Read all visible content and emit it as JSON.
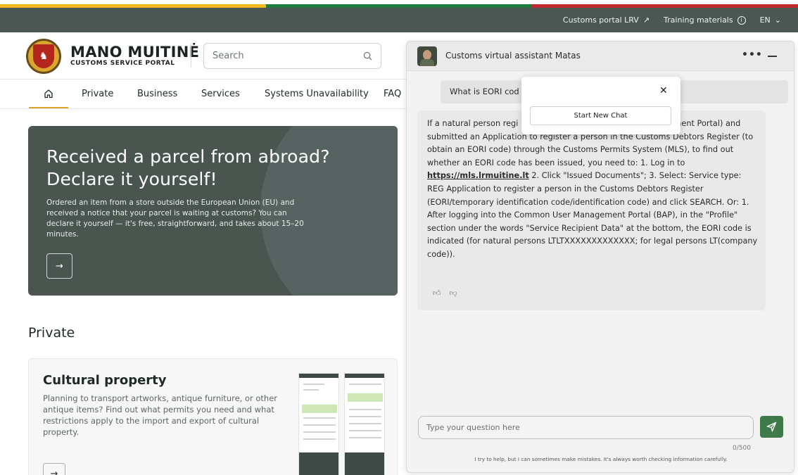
{
  "flag_colors": [
    "#f2b91f",
    "#1f7a3e",
    "#c1272d"
  ],
  "topbar": {
    "links": [
      {
        "label": "Customs portal LRV",
        "icon": "external-arrow-icon"
      },
      {
        "label": "Training materials",
        "icon": "info-icon"
      },
      {
        "label": "EN",
        "icon": "chevron-down-icon"
      }
    ]
  },
  "brand": {
    "title": "MANO MUITINĖ",
    "subtitle": "CUSTOMS SERVICE PORTAL"
  },
  "search": {
    "placeholder": "Search"
  },
  "nav": {
    "items": [
      "Private",
      "Business",
      "Services",
      "Systems Unavailability",
      "FAQ"
    ]
  },
  "hero": {
    "title": "Received a parcel from abroad? Declare it yourself!",
    "text": "Ordered an item from a store outside the European Union (EU) and received a notice that your parcel is waiting at customs? You can declare it yourself — it's free, straightforward, and takes about 15–20 minutes."
  },
  "section": {
    "title": "Private"
  },
  "card": {
    "title": "Cultural property",
    "text": "Planning to transport artworks, antique furniture, or other antique items? Find out what permits you need and what restrictions apply to the import and export of cultural property."
  },
  "chat": {
    "title": "Customs virtual assistant Matas",
    "user_message": "What is EORI cod",
    "popup": {
      "button": "Start New Chat"
    },
    "bot_message": {
      "part1": "If a natural person regi",
      "part1b": "agement Portal) and submitted an Application to register a person in the Customs Debtors Register (to obtain an EORI code) through the Customs Permits System (MLS), to find out whether an EORI code has been issued, you need to: 1. Log in to ",
      "link": "https://mls.lrmuitine.lt",
      "part2": " 2. Click \"Issued Documents\"; 3. Select: Service type: REG Application to register a person in the Customs Debtors Register (EORI/temporary identification code/identification code) and click SEARCH. Or: 1. After logging into the Common User Management Portal (BAP), in the \"Profile\" section under the words \"Service Recipient Data\" at the bottom, the EORI code is indicated (for natural persons LTLTXXXXXXXXXXXXX; for legal persons LT(company code))."
    },
    "input": {
      "placeholder": "Type your question here",
      "counter": "0/500"
    },
    "disclaimer": "I try to help, but I can sometimes make mistakes. It's always worth checking information carefully."
  }
}
